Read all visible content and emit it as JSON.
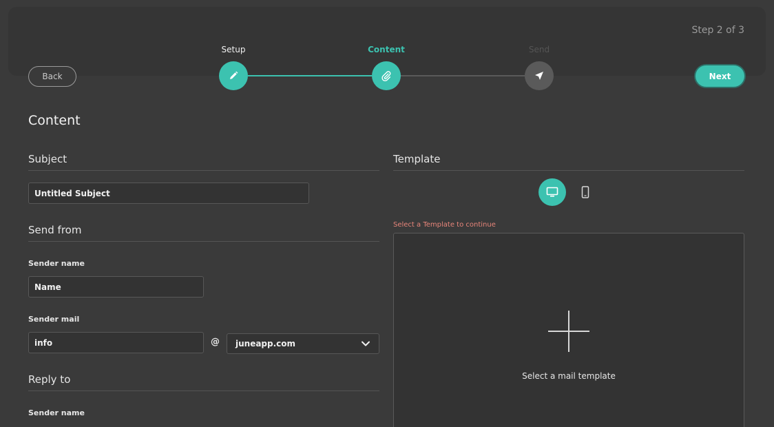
{
  "wizard": {
    "step_counter": "Step 2 of 3",
    "back_label": "Back",
    "next_label": "Next",
    "steps": [
      {
        "label": "Setup",
        "status": "done",
        "icon": "pencil-icon"
      },
      {
        "label": "Content",
        "status": "active",
        "icon": "paperclip-icon"
      },
      {
        "label": "Send",
        "status": "todo",
        "icon": "send-icon"
      }
    ]
  },
  "content": {
    "title": "Content",
    "subject": {
      "section_title": "Subject",
      "value": "Untitled Subject"
    },
    "send_from": {
      "section_title": "Send from",
      "sender_name_label": "Sender name",
      "sender_name_value": "Name",
      "sender_mail_label": "Sender mail",
      "sender_mail_value": "info",
      "at_sign": "@",
      "domain_selected": "juneapp.com"
    },
    "reply_to": {
      "section_title": "Reply to",
      "sender_name_label": "Sender name"
    },
    "template": {
      "section_title": "Template",
      "warning": "Select a Template to continue",
      "cta": "Select a mail template",
      "view_modes": [
        "desktop",
        "mobile"
      ],
      "active_view": "desktop"
    }
  },
  "colors": {
    "accent": "#3cc2b0",
    "background": "#3a3a3a",
    "warning": "#e8857a"
  }
}
